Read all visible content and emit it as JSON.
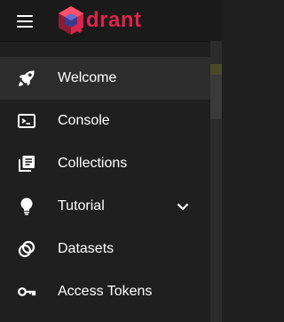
{
  "header": {
    "logo_text": "drant",
    "menu_icon": "hamburger-menu-icon",
    "brand_color": "#dc244c"
  },
  "sidebar": {
    "items": [
      {
        "label": "Welcome",
        "icon": "rocket-icon",
        "active": true
      },
      {
        "label": "Console",
        "icon": "terminal-icon",
        "active": false
      },
      {
        "label": "Collections",
        "icon": "collections-icon",
        "active": false
      },
      {
        "label": "Tutorial",
        "icon": "lightbulb-icon",
        "active": false,
        "expandable": true
      },
      {
        "label": "Datasets",
        "icon": "datasets-icon",
        "active": false
      },
      {
        "label": "Access Tokens",
        "icon": "key-icon",
        "active": false
      }
    ]
  },
  "colors": {
    "background": "#1f1f1f",
    "active_item": "#2d2d2d",
    "text": "#ffffff"
  }
}
